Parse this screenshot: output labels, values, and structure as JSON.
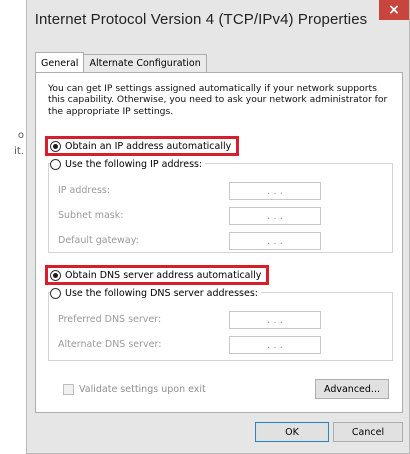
{
  "background": {
    "lines": [
      "o",
      "it."
    ]
  },
  "window": {
    "title": "Internet Protocol Version 4 (TCP/IPv4) Properties",
    "close_glyph": "×"
  },
  "tabs": [
    {
      "label": "General",
      "active": true
    },
    {
      "label": "Alternate Configuration",
      "active": false
    }
  ],
  "intro_text": "You can get IP settings assigned automatically if your network supports this capability. Otherwise, you need to ask your network administrator for the appropriate IP settings.",
  "ip_section": {
    "auto_label": "Obtain an IP address automatically",
    "auto_selected": true,
    "manual_label": "Use the following IP address:",
    "manual_selected": false,
    "fields": [
      {
        "label": "IP address:",
        "value": ". . ."
      },
      {
        "label": "Subnet mask:",
        "value": ". . ."
      },
      {
        "label": "Default gateway:",
        "value": ". . ."
      }
    ]
  },
  "dns_section": {
    "auto_label": "Obtain DNS server address automatically",
    "auto_selected": true,
    "manual_label": "Use the following DNS server addresses:",
    "manual_selected": false,
    "fields": [
      {
        "label": "Preferred DNS server:",
        "value": ". . ."
      },
      {
        "label": "Alternate DNS server:",
        "value": ". . ."
      }
    ]
  },
  "validate_label": "Validate settings upon exit",
  "validate_checked": false,
  "buttons": {
    "advanced": "Advanced...",
    "ok": "OK",
    "cancel": "Cancel"
  },
  "colors": {
    "highlight": "#d81e2c",
    "close_button": "#c7453d",
    "disabled_text": "#9a9a9a"
  }
}
